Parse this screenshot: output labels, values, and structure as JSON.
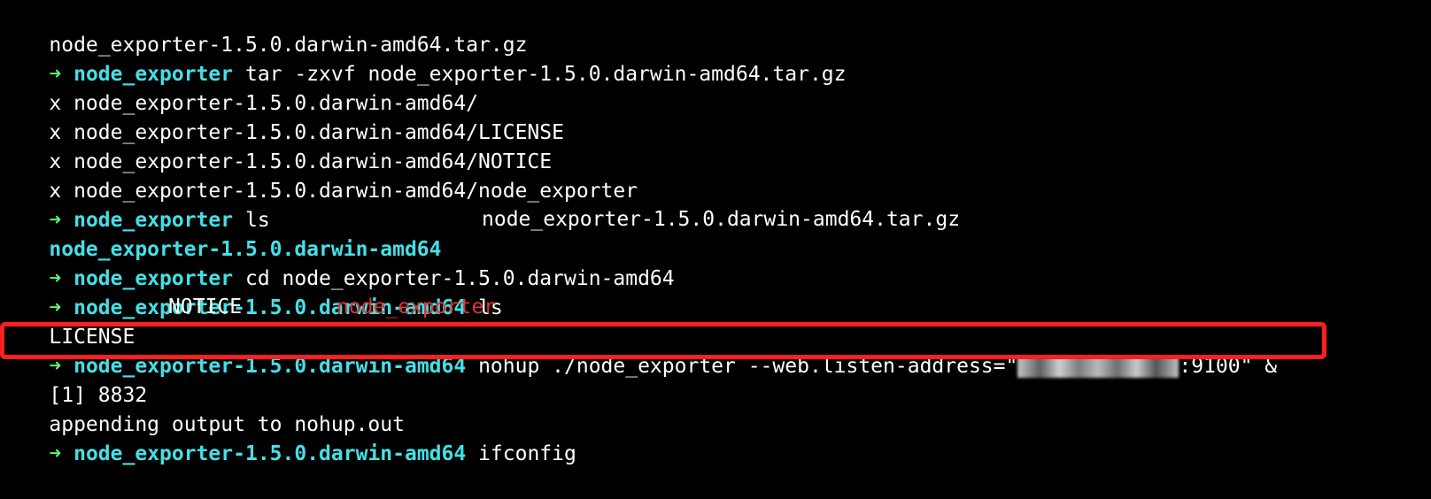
{
  "terminal": {
    "prompt_symbol": "➜",
    "colors": {
      "arrow": "#5ff26f",
      "directory": "#44e0e6",
      "executable": "#e0332f",
      "highlight": "#ff1f1f"
    },
    "lines": {
      "l1": {
        "text": "node_exporter-1.5.0.darwin-amd64.tar.gz"
      },
      "l2": {
        "dir": "node_exporter",
        "cmd": " tar -zxvf node_exporter-1.5.0.darwin-amd64.tar.gz"
      },
      "l3": {
        "text": "x node_exporter-1.5.0.darwin-amd64/"
      },
      "l4": {
        "text": "x node_exporter-1.5.0.darwin-amd64/LICENSE"
      },
      "l5": {
        "text": "x node_exporter-1.5.0.darwin-amd64/NOTICE"
      },
      "l6": {
        "text": "x node_exporter-1.5.0.darwin-amd64/node_exporter"
      },
      "l7": {
        "dir": "node_exporter",
        "cmd": " ls"
      },
      "l8": {
        "col1": "node_exporter-1.5.0.darwin-amd64",
        "col2": "node_exporter-1.5.0.darwin-amd64.tar.gz"
      },
      "l9": {
        "dir": "node_exporter",
        "cmd": " cd node_exporter-1.5.0.darwin-amd64"
      },
      "l10": {
        "dir": "node_exporter-1.5.0.darwin-amd64",
        "cmd": " ls"
      },
      "l11": {
        "col1": "LICENSE",
        "col2": "NOTICE",
        "col3": "node_exporter"
      },
      "l12": {
        "dir": "node_exporter-1.5.0.darwin-amd64",
        "cmd_before": " nohup ./node_exporter --web.listen-address=\"",
        "cmd_after": ":9100\" &"
      },
      "l13": {
        "text": "[1] 8832"
      },
      "l14": {
        "text": "appending output to nohup.out"
      },
      "l15": {
        "dir": "node_exporter-1.5.0.darwin-amd64",
        "cmd": " ifconfig"
      }
    }
  }
}
